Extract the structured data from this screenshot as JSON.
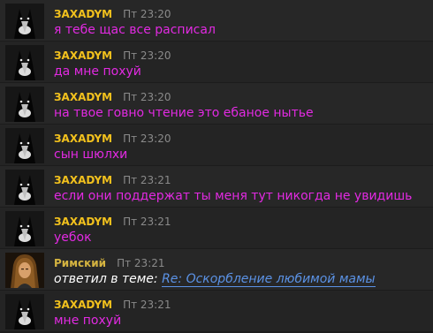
{
  "colors": {
    "author_default": "#f2c11d",
    "author_alt": "#d4b340",
    "message_text": "#e22ae2",
    "timestamp": "#8a8a8a",
    "link": "#5b92e5"
  },
  "icons": {
    "default_avatar": "black-cat-avatar-icon",
    "alt_avatar": "long-haired-man-portrait-icon"
  },
  "messages": [
    {
      "author": "ЗАXADYM",
      "time": "Пт 23:20",
      "text": "я тебе щас все расписал"
    },
    {
      "author": "ЗАXADYM",
      "time": "Пт 23:20",
      "text": "да мне похуй"
    },
    {
      "author": "ЗАXADYM",
      "time": "Пт 23:20",
      "text": "на твое говно чтение это ебаное нытье"
    },
    {
      "author": "ЗАXADYM",
      "time": "Пт 23:20",
      "text": "сын шюлхи"
    },
    {
      "author": "ЗАXADYM",
      "time": "Пт 23:21",
      "text": "если они поддержат ты меня тут никогда не увидишь"
    },
    {
      "author": "ЗАXADYM",
      "time": "Пт 23:21",
      "text": "уебок"
    },
    {
      "author": "Римский",
      "time": "Пт 23:21",
      "reply_prefix": "ответил в теме:",
      "reply_link": "Re: Оскорбление любимой мамы"
    },
    {
      "author": "ЗАXADYM",
      "time": "Пт 23:21",
      "text": "мне похуй"
    }
  ]
}
